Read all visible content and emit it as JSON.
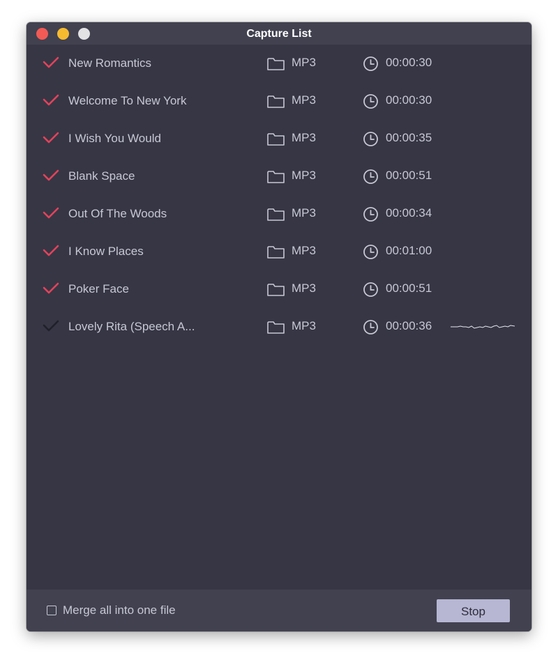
{
  "window": {
    "title": "Capture List"
  },
  "colors": {
    "check_active": "#e3435a",
    "check_inactive": "#20202a",
    "text": "#c7c8d4",
    "background": "#363645",
    "button": "#b7b6d3"
  },
  "tracks": [
    {
      "name": "New Romantics",
      "format": "MP3",
      "duration": "00:00:30",
      "checked": true,
      "recording": false
    },
    {
      "name": "Welcome To New York",
      "format": "MP3",
      "duration": "00:00:30",
      "checked": true,
      "recording": false
    },
    {
      "name": "I Wish You Would",
      "format": "MP3",
      "duration": "00:00:35",
      "checked": true,
      "recording": false
    },
    {
      "name": "Blank Space",
      "format": "MP3",
      "duration": "00:00:51",
      "checked": true,
      "recording": false
    },
    {
      "name": "Out Of The Woods",
      "format": "MP3",
      "duration": "00:00:34",
      "checked": true,
      "recording": false
    },
    {
      "name": "I Know Places",
      "format": "MP3",
      "duration": "00:01:00",
      "checked": true,
      "recording": false
    },
    {
      "name": "Poker Face",
      "format": "MP3",
      "duration": "00:00:51",
      "checked": true,
      "recording": false
    },
    {
      "name": "Lovely Rita (Speech A...",
      "format": "MP3",
      "duration": "00:00:36",
      "checked": false,
      "recording": true
    }
  ],
  "footer": {
    "merge_label": "Merge all into one file",
    "merge_checked": false,
    "stop_label": "Stop"
  }
}
